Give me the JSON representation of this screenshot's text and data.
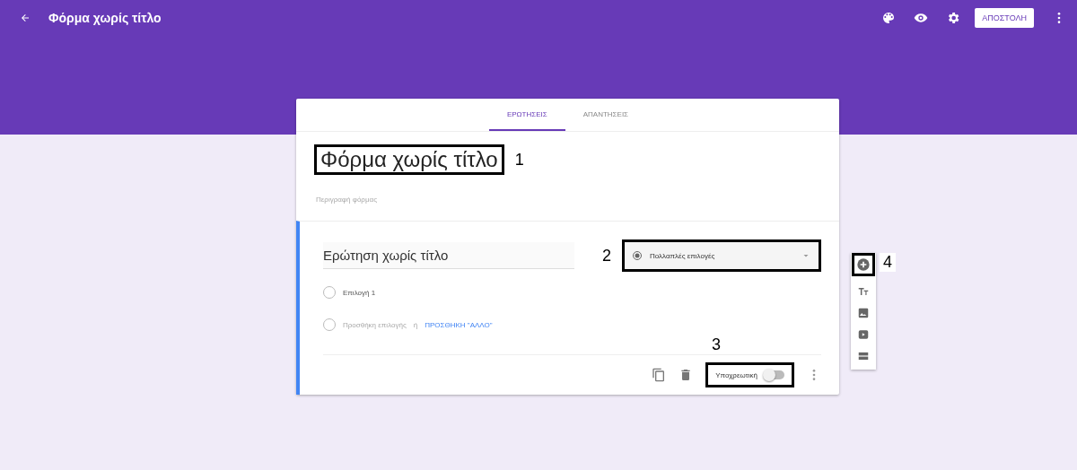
{
  "app_bar": {
    "title": "Φόρμα χωρίς τίτλο",
    "send_button": "ΑΠΟΣΤΟΛΗ"
  },
  "tabs": [
    {
      "label": "ΕΡΩΤΗΣΕΙΣ",
      "selected": true
    },
    {
      "label": "ΑΠΑΝΤΗΣΕΙΣ",
      "selected": false
    }
  ],
  "form": {
    "title": "Φόρμα χωρίς τίτλο",
    "title_callout": "1",
    "description_placeholder": "Περιγραφή φόρμας"
  },
  "question": {
    "title": "Ερώτηση χωρίς τίτλο",
    "type": "Πολλαπλές επιλογές",
    "type_callout": "2",
    "options": [
      {
        "label": "Επιλογή 1"
      }
    ],
    "add_option": "Προσθήκη επιλογής",
    "or": "ή",
    "add_other": "ΠΡΟΣΘΗΚΗ \"ΑΛΛΟ\"",
    "required": {
      "label": "Υποχρεωτική",
      "on": false,
      "callout": "3"
    }
  },
  "side_toolbar": {
    "callout": "4"
  }
}
